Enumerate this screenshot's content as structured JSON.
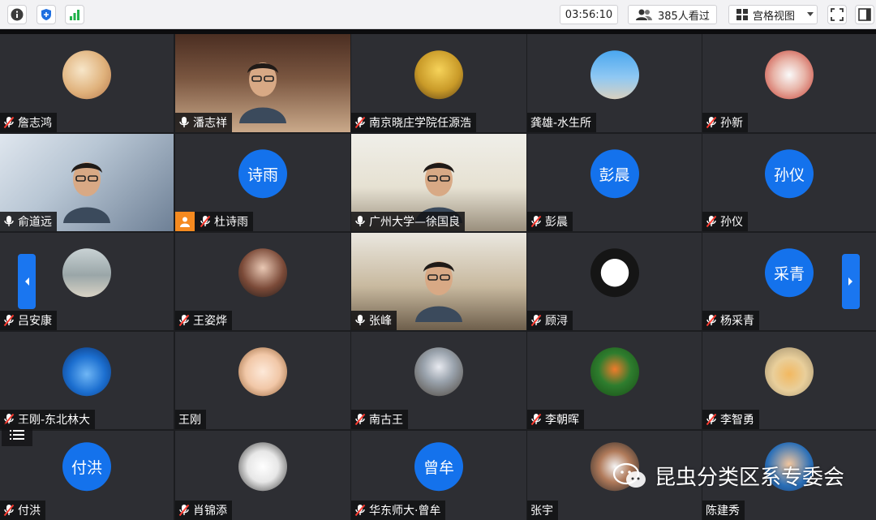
{
  "topbar": {
    "timer": "03:56:10",
    "viewers": "385人看过",
    "view_mode": "宫格视图"
  },
  "colors": {
    "accent_blue": "#1472ec",
    "tile_bg": "#2d2e33",
    "muted_mic": "#ff3b30",
    "host_badge": "#f58a1f"
  },
  "tiles": [
    {
      "name": "詹志鸿",
      "avatar": "illustration",
      "mic": "muted"
    },
    {
      "name": "潘志祥",
      "avatar": "video",
      "mic": "on"
    },
    {
      "name": "南京晓庄学院任源浩",
      "avatar": "anime",
      "mic": "muted"
    },
    {
      "name": "龚雄-水生所",
      "avatar": "landscape",
      "mic": "none"
    },
    {
      "name": "孙新",
      "avatar": "toy",
      "mic": "muted"
    },
    {
      "name": "俞道远",
      "avatar": "video",
      "mic": "on"
    },
    {
      "name": "杜诗雨",
      "avatar_text": "诗雨",
      "mic": "muted",
      "badge": "host"
    },
    {
      "name": "广州大学—徐国良",
      "avatar": "video",
      "mic": "on"
    },
    {
      "name": "彭晨",
      "avatar_text": "彭晨",
      "mic": "muted"
    },
    {
      "name": "孙仪",
      "avatar_text": "孙仪",
      "mic": "muted"
    },
    {
      "name": "吕安康",
      "avatar": "beach",
      "mic": "muted"
    },
    {
      "name": "王姿烨",
      "avatar": "portrait",
      "mic": "muted"
    },
    {
      "name": "张峰",
      "avatar": "video",
      "mic": "on"
    },
    {
      "name": "顾浔",
      "avatar": "cat",
      "mic": "muted"
    },
    {
      "name": "杨采青",
      "avatar_text": "采青",
      "mic": "muted"
    },
    {
      "name": "王刚-东北林大",
      "avatar": "blue-bubble",
      "mic": "muted"
    },
    {
      "name": "王刚",
      "avatar": "cartoon",
      "mic": "none"
    },
    {
      "name": "南古王",
      "avatar": "horse",
      "mic": "muted"
    },
    {
      "name": "李朝晖",
      "avatar": "butterfly",
      "mic": "muted"
    },
    {
      "name": "李智勇",
      "avatar": "starfish",
      "mic": "muted"
    },
    {
      "name": "付洪",
      "avatar_text": "付洪",
      "mic": "muted"
    },
    {
      "name": "肖锦添",
      "avatar": "sketch",
      "mic": "muted"
    },
    {
      "name": "华东师大·曾牟",
      "avatar_text": "曾牟",
      "mic": "muted"
    },
    {
      "name": "张宇",
      "avatar": "portrait2",
      "mic": "none"
    },
    {
      "name": "陈建秀",
      "avatar": "glasses",
      "mic": "none"
    }
  ],
  "watermark": {
    "text": "昆虫分类区系专委会"
  }
}
